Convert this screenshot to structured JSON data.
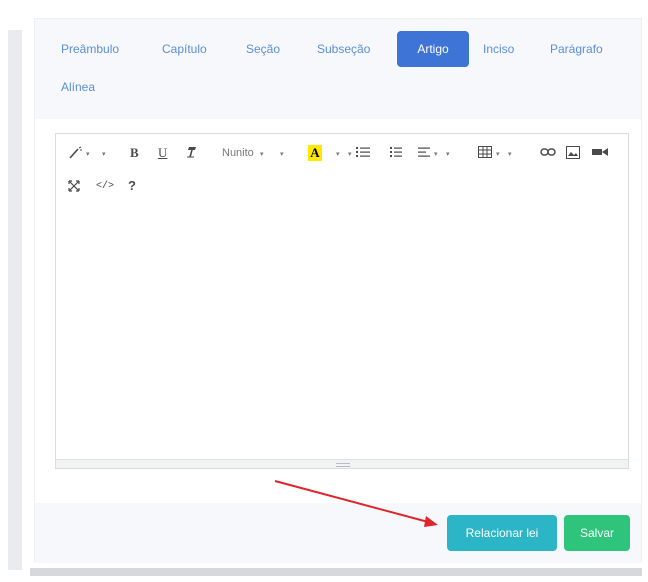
{
  "tabs": [
    {
      "label": "Preâmbulo",
      "active": false
    },
    {
      "label": "Capítulo",
      "active": false
    },
    {
      "label": "Seção",
      "active": false
    },
    {
      "label": "Subseção",
      "active": false
    },
    {
      "label": "Artigo",
      "active": true
    },
    {
      "label": "Inciso",
      "active": false
    },
    {
      "label": "Parágrafo",
      "active": false
    },
    {
      "label": "Alínea",
      "active": false
    }
  ],
  "toolbar": {
    "style_icon": "magic-icon",
    "bold": "B",
    "underline": "U",
    "eraser_icon": "eraser-icon",
    "font_name": "Nunito",
    "color_letter": "A",
    "unordered_list_icon": "ul-list-icon",
    "ordered_list_icon": "ol-list-icon",
    "align_icon": "align-icon",
    "table_icon": "table-icon",
    "link_icon": "link-icon",
    "picture_icon": "picture-icon",
    "video_icon": "video-icon",
    "fullscreen_icon": "fullscreen-icon",
    "codeview": "</>",
    "help": "?"
  },
  "footer": {
    "relate_button": "Relacionar lei",
    "save_button": "Salvar"
  },
  "colors": {
    "tab_text": "#5b8fd8",
    "active_tab": "#3e74d6",
    "relate_button": "#2bb5c6",
    "save_button": "#2ec47b",
    "arrow": "#e0242b",
    "highlight": "#ffe900"
  }
}
